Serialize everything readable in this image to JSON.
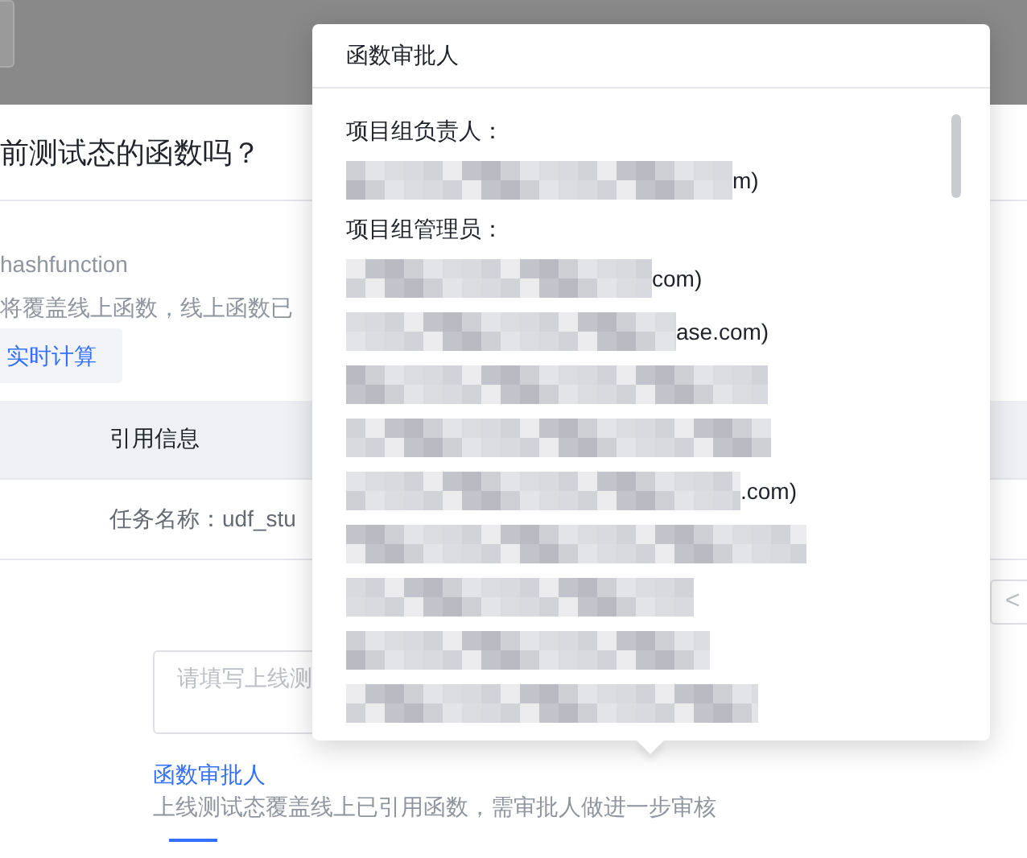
{
  "dialog": {
    "title": "前测试态的函数吗？",
    "function_name": "hashfunction",
    "warning": "将覆盖线上函数，线上函数已",
    "tag": "实时计算",
    "table": {
      "columns": [
        "引用信息"
      ],
      "rows": [
        [
          "任务名称：udf_stu"
        ]
      ]
    },
    "pager_prev": "<",
    "remark": {
      "placeholder": "请填写上线测"
    },
    "approver_link": "函数审批人",
    "approver_hint": "上线测试态覆盖线上已引用函数，需审批人做进一步审核"
  },
  "popover": {
    "title": "函数审批人",
    "sections": [
      {
        "label": "项目组负责人：",
        "entries": [
          {
            "kind": "redacted",
            "suffix": "m)"
          }
        ]
      },
      {
        "label": "项目组管理员：",
        "entries": [
          {
            "kind": "redacted",
            "suffix": "com)"
          },
          {
            "kind": "redacted",
            "suffix": "ase.com)"
          },
          {
            "kind": "redacted"
          },
          {
            "kind": "redacted"
          },
          {
            "kind": "redacted",
            "suffix": ".com)"
          },
          {
            "kind": "redacted"
          },
          {
            "kind": "redacted"
          },
          {
            "kind": "redacted"
          },
          {
            "kind": "redacted"
          }
        ]
      }
    ]
  }
}
